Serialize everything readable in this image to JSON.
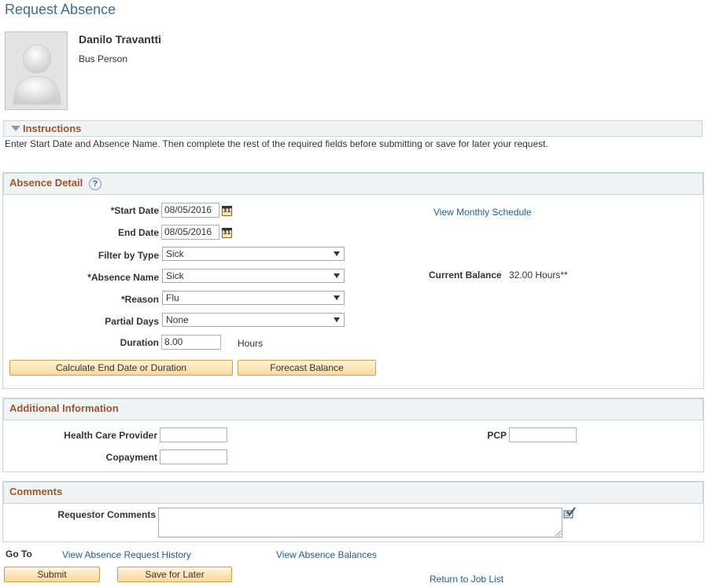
{
  "page": {
    "title": "Request Absence"
  },
  "employee": {
    "name": "Danilo Travantti",
    "job_title": "Bus Person"
  },
  "instructions": {
    "header": "Instructions",
    "text": "Enter Start Date and Absence Name. Then complete the rest of the required fields before submitting or save for later your request."
  },
  "absence_detail": {
    "header": "Absence Detail",
    "help_symbol": "?",
    "start_date_label": "*Start Date",
    "start_date_value": "08/05/2016",
    "end_date_label": "End Date",
    "end_date_value": "08/05/2016",
    "calendar_icon_text": "31",
    "filter_by_type_label": "Filter by Type",
    "filter_by_type_value": "Sick",
    "absence_name_label": "*Absence Name",
    "absence_name_value": "Sick",
    "reason_label": "*Reason",
    "reason_value": "Flu",
    "partial_days_label": "Partial Days",
    "partial_days_value": "None",
    "duration_label": "Duration",
    "duration_value": "8.00",
    "duration_unit": "Hours",
    "view_monthly_schedule": "View Monthly Schedule",
    "current_balance_label": "Current Balance",
    "current_balance_value": "32.00 Hours**",
    "calculate_button": "Calculate End Date or Duration",
    "forecast_button": "Forecast Balance"
  },
  "additional_info": {
    "header": "Additional Information",
    "health_care_provider_label": "Health Care Provider",
    "health_care_provider_value": "",
    "copayment_label": "Copayment",
    "copayment_value": "",
    "pcp_label": "PCP",
    "pcp_value": ""
  },
  "comments": {
    "header": "Comments",
    "requestor_comments_label": "Requestor Comments",
    "requestor_comments_value": ""
  },
  "footer": {
    "go_to_label": "Go To",
    "view_history_link": "View Absence Request History",
    "view_balances_link": "View Absence Balances",
    "submit_button": "Submit",
    "save_later_button": "Save for Later",
    "return_link": "Return to Job List"
  },
  "colors": {
    "title": "#426a92",
    "section_header_text": "#a0522d",
    "section_header_bg": "#f0f4f4",
    "link": "#235e8a",
    "button_bg": "#f9d79a"
  }
}
